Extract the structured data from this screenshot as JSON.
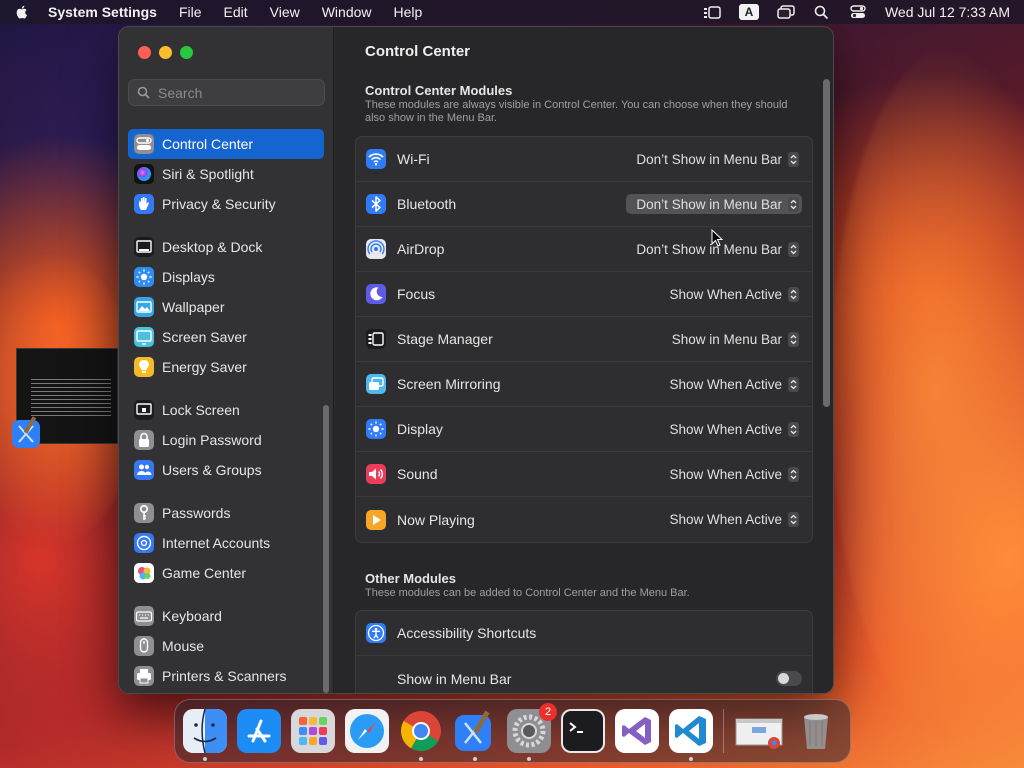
{
  "menubar": {
    "app_name": "System Settings",
    "menus": [
      "File",
      "Edit",
      "View",
      "Window",
      "Help"
    ],
    "input_source": "A",
    "clock": "Wed Jul 12  7:33 AM"
  },
  "sidebar": {
    "search_placeholder": "Search",
    "groups": [
      [
        {
          "label": "Control Center",
          "icon": "control-center-icon",
          "color": "#8e8e93",
          "active": true
        },
        {
          "label": "Siri & Spotlight",
          "icon": "siri-icon",
          "color": "#b04ad8"
        },
        {
          "label": "Privacy & Security",
          "icon": "hand-icon",
          "color": "#3478f6"
        }
      ],
      [
        {
          "label": "Desktop & Dock",
          "icon": "dock-icon",
          "color": "#1c1c1e"
        },
        {
          "label": "Displays",
          "icon": "sun-icon",
          "color": "#2f8cf5"
        },
        {
          "label": "Wallpaper",
          "icon": "wallpaper-icon",
          "color": "#35a7e8"
        },
        {
          "label": "Screen Saver",
          "icon": "screensaver-icon",
          "color": "#4cc0e4"
        },
        {
          "label": "Energy Saver",
          "icon": "bulb-icon",
          "color": "#f5b82a"
        }
      ],
      [
        {
          "label": "Lock Screen",
          "icon": "lock-screen-icon",
          "color": "#1c1c1e"
        },
        {
          "label": "Login Password",
          "icon": "lock-icon",
          "color": "#8e8e93"
        },
        {
          "label": "Users & Groups",
          "icon": "users-icon",
          "color": "#3478f6"
        }
      ],
      [
        {
          "label": "Passwords",
          "icon": "key-icon",
          "color": "#8e8e93"
        },
        {
          "label": "Internet Accounts",
          "icon": "at-icon",
          "color": "#3478f6"
        },
        {
          "label": "Game Center",
          "icon": "game-center-icon",
          "color": "#ffffff"
        }
      ],
      [
        {
          "label": "Keyboard",
          "icon": "keyboard-icon",
          "color": "#8e8e93"
        },
        {
          "label": "Mouse",
          "icon": "mouse-icon",
          "color": "#8e8e93"
        },
        {
          "label": "Printers & Scanners",
          "icon": "printer-icon",
          "color": "#8e8e93"
        }
      ]
    ]
  },
  "content": {
    "title": "Control Center",
    "modules_title": "Control Center Modules",
    "modules_desc": "These modules are always visible in Control Center. You can choose when they should also show in the Menu Bar.",
    "modules": [
      {
        "label": "Wi-Fi",
        "icon": "wifi-icon",
        "color": "#2f7cf6",
        "value": "Don’t Show in Menu Bar"
      },
      {
        "label": "Bluetooth",
        "icon": "bluetooth-icon",
        "color": "#2f7cf6",
        "value": "Don’t Show in Menu Bar",
        "highlighted": true
      },
      {
        "label": "AirDrop",
        "icon": "airdrop-icon",
        "color": "#e8e8ea",
        "value": "Don’t Show in Menu Bar"
      },
      {
        "label": "Focus",
        "icon": "moon-icon",
        "color": "#5e5ce6",
        "value": "Show When Active"
      },
      {
        "label": "Stage Manager",
        "icon": "stage-manager-icon",
        "color": "#1c1c1e",
        "value": "Show in Menu Bar"
      },
      {
        "label": "Screen Mirroring",
        "icon": "screen-mirroring-icon",
        "color": "#4fb8f0",
        "value": "Show When Active"
      },
      {
        "label": "Display",
        "icon": "sun-icon",
        "color": "#2f7cf6",
        "value": "Show When Active"
      },
      {
        "label": "Sound",
        "icon": "speaker-icon",
        "color": "#ec3c5a",
        "value": "Show When Active"
      },
      {
        "label": "Now Playing",
        "icon": "play-icon",
        "color": "#f7a628",
        "value": "Show When Active"
      }
    ],
    "other_title": "Other Modules",
    "other_desc": "These modules can be added to Control Center and the Menu Bar.",
    "other": [
      {
        "label": "Accessibility Shortcuts",
        "icon": "accessibility-icon",
        "color": "#2f7cf6"
      },
      {
        "label": "Show in Menu Bar",
        "toggle": false
      }
    ]
  },
  "dock": {
    "apps": [
      {
        "name": "finder-icon",
        "color": "#3d8ff5",
        "running": true
      },
      {
        "name": "app-store-icon",
        "color": "#1d8cf4",
        "running": false
      },
      {
        "name": "launchpad-icon",
        "color": "#d8d8dc",
        "running": false
      },
      {
        "name": "safari-icon",
        "color": "#2b9cf5",
        "running": false
      },
      {
        "name": "chrome-icon",
        "color": "#ffffff",
        "running": true
      },
      {
        "name": "xcode-icon",
        "color": "#2f7ff6",
        "running": true
      },
      {
        "name": "system-settings-icon",
        "color": "#8e8e93",
        "running": true,
        "badge": "2"
      },
      {
        "name": "terminal-icon",
        "color": "#1c1c1e",
        "running": false
      },
      {
        "name": "visual-studio-icon",
        "color": "#ffffff",
        "running": false
      },
      {
        "name": "vscode-icon",
        "color": "#ffffff",
        "running": true
      },
      {
        "name": "chrome-window-thumbnail",
        "color": "#dcdcdc",
        "running": false
      },
      {
        "name": "trash-icon",
        "color": "#9a9a9e",
        "running": false
      }
    ]
  }
}
